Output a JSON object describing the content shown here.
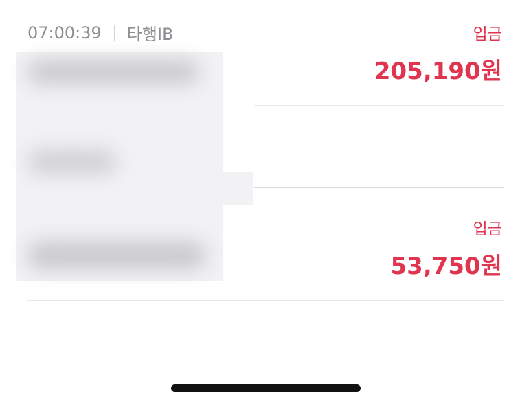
{
  "transactions": [
    {
      "time": "07:00:39",
      "counterparty": "타행IB",
      "type": "입금",
      "amount": "205,190원"
    },
    {
      "type": "입금",
      "amount": "53,750원"
    }
  ],
  "colors": {
    "accent_red": "#e0344f",
    "meta_gray": "#8e8e93"
  }
}
